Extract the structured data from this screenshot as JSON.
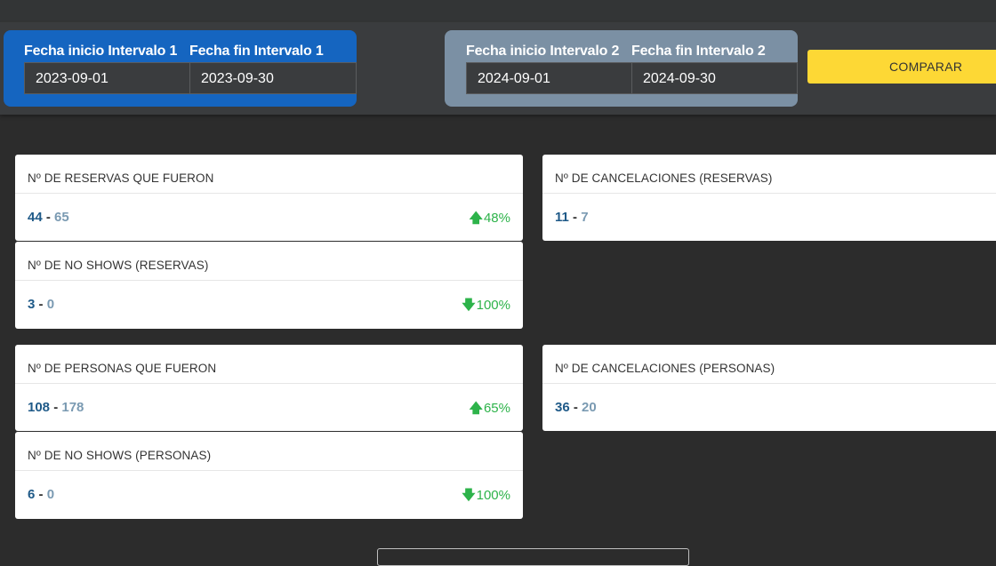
{
  "filters": {
    "interval1": {
      "start_label": "Fecha inicio Intervalo 1",
      "end_label": "Fecha fin Intervalo 1",
      "start_value": "2023-09-01",
      "end_value": "2023-09-30",
      "color": "#1565c0"
    },
    "interval2": {
      "start_label": "Fecha inicio Intervalo 2",
      "end_label": "Fecha fin Intervalo 2",
      "start_value": "2024-09-01",
      "end_value": "2024-09-30",
      "color": "#7b90a4"
    },
    "compare_label": "COMPARAR",
    "compare_color": "#fdd835"
  },
  "cards": [
    {
      "title": "Nº DE RESERVAS QUE FUERON",
      "value1": "44",
      "value2": "65",
      "change": "48%",
      "direction": "up"
    },
    {
      "title": "Nº DE NO SHOWS (RESERVAS)",
      "value1": "3",
      "value2": "0",
      "change": "100%",
      "direction": "down"
    },
    {
      "title": "Nº DE CANCELACIONES (RESERVAS)",
      "value1": "11",
      "value2": "7",
      "change": "",
      "direction": ""
    },
    {
      "title": "Nº DE PERSONAS QUE FUERON",
      "value1": "108",
      "value2": "178",
      "change": "65%",
      "direction": "up"
    },
    {
      "title": "Nº DE NO SHOWS (PERSONAS)",
      "value1": "6",
      "value2": "0",
      "change": "100%",
      "direction": "down"
    },
    {
      "title": "Nº DE CANCELACIONES (PERSONAS)",
      "value1": "36",
      "value2": "20",
      "change": "",
      "direction": ""
    }
  ],
  "separator": "-",
  "icons": {
    "up": "arrow-up-icon",
    "down": "arrow-down-icon"
  },
  "colors": {
    "positive": "#2db34a",
    "value1": "#1f5a88",
    "value2": "#7a9ab2"
  }
}
